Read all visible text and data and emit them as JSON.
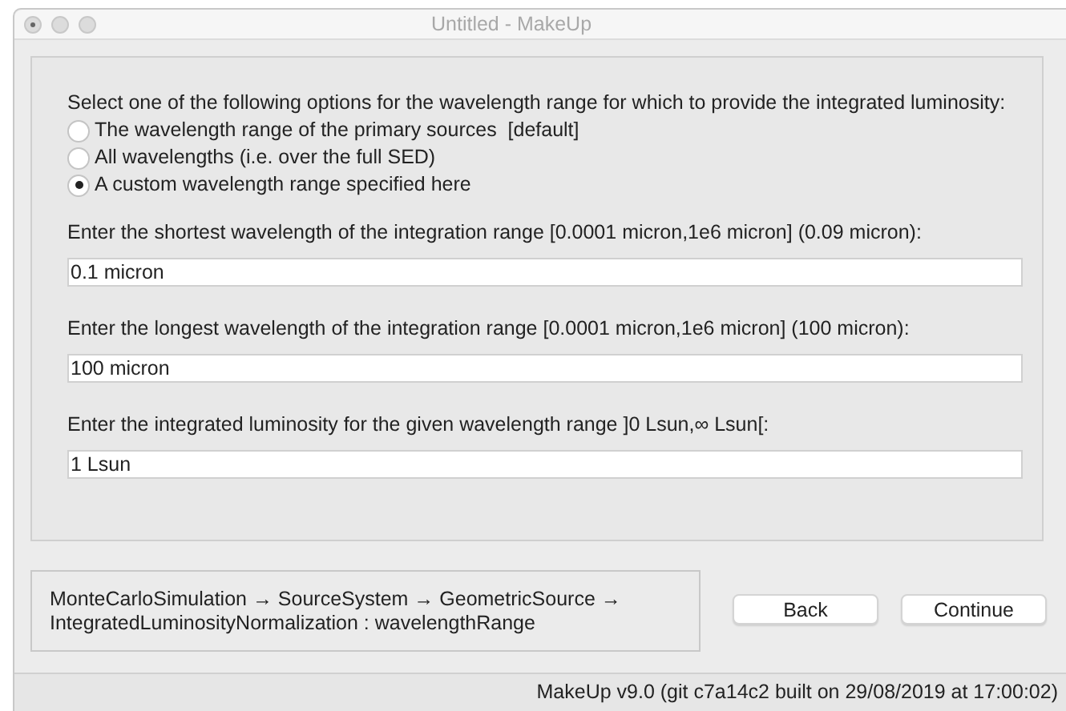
{
  "window": {
    "title": "Untitled - MakeUp"
  },
  "question": "Select one of the following options for the wavelength range for which to provide the integrated luminosity:",
  "options": [
    {
      "label": "The wavelength range of the primary sources  [default]",
      "selected": false
    },
    {
      "label": "All wavelengths (i.e. over the full SED)",
      "selected": false
    },
    {
      "label": "A custom wavelength range specified here",
      "selected": true
    }
  ],
  "fields": [
    {
      "label": "Enter the shortest wavelength of the integration range [0.0001 micron,1e6 micron] (0.09 micron):",
      "value": "0.1 micron"
    },
    {
      "label": "Enter the longest wavelength of the integration range [0.0001 micron,1e6 micron] (100 micron):",
      "value": "100 micron"
    },
    {
      "label": "Enter the integrated luminosity for the given wavelength range ]0 Lsun,∞ Lsun[:",
      "value": "1 Lsun"
    }
  ],
  "breadcrumb": [
    "MonteCarloSimulation → SourceSystem → GeometricSource →",
    "IntegratedLuminosityNormalization : wavelengthRange"
  ],
  "buttons": [
    "Back",
    "Continue"
  ],
  "status_bar": "MakeUp v9.0 (git c7a14c2 built on 29/08/2019 at 17:00:02)"
}
